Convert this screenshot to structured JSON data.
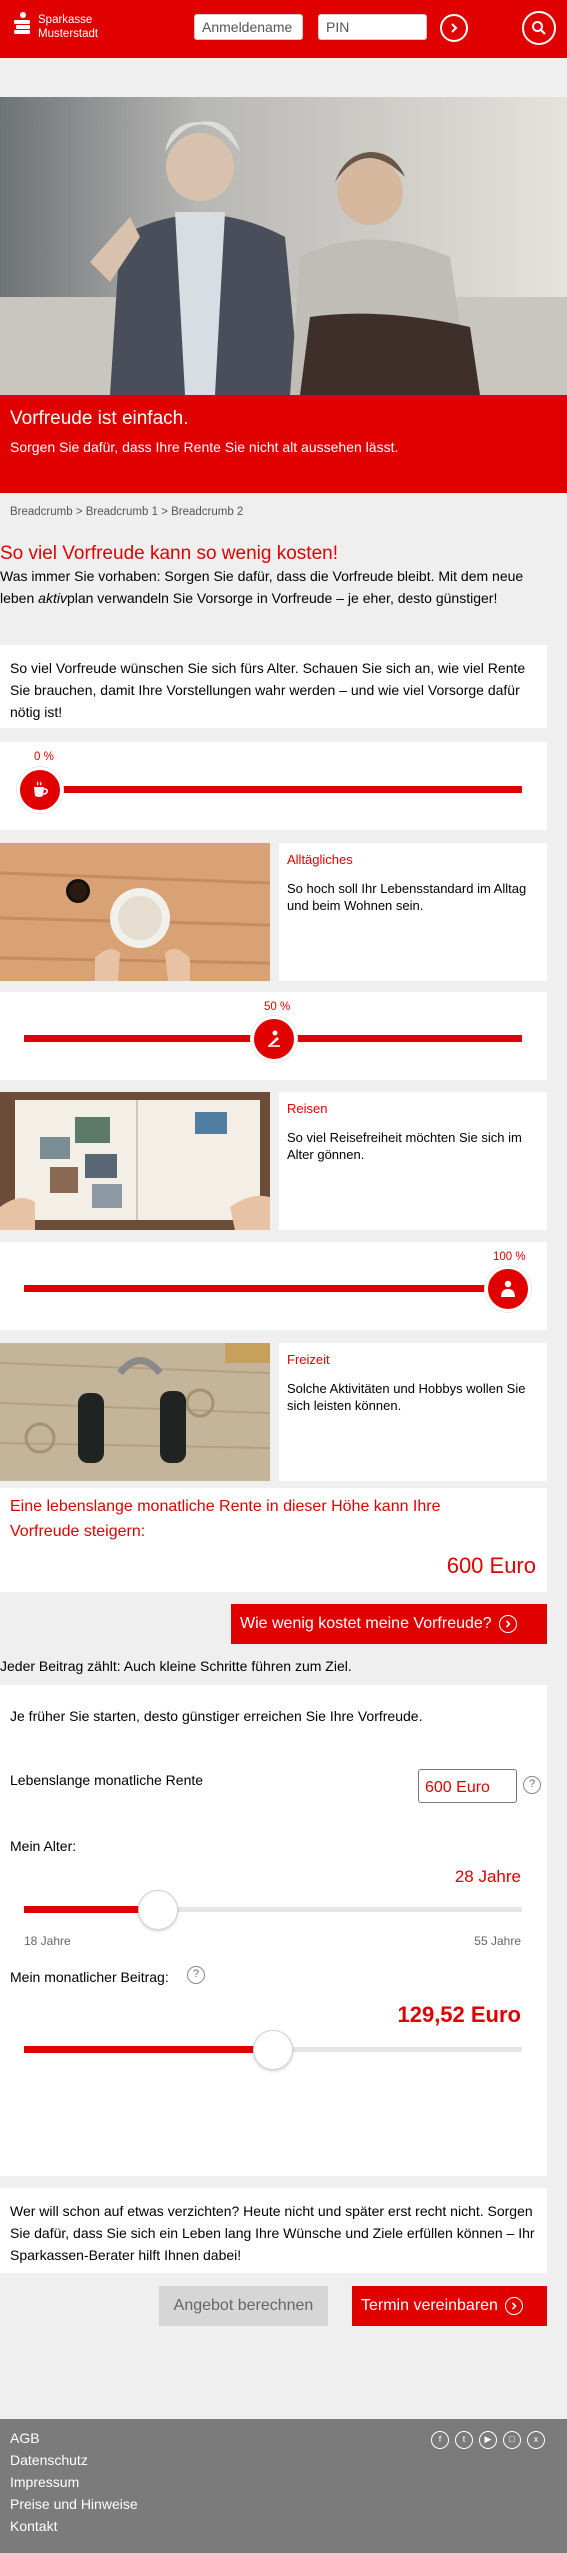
{
  "header": {
    "logo_line1": "Sparkasse",
    "logo_line2": "Musterstadt",
    "username_placeholder": "Anmeldename",
    "pin_placeholder": "PIN",
    "brand_color": "#e00000"
  },
  "hero": {
    "title": "Vorfreude ist einfach.",
    "subtitle": "Sorgen Sie dafür, dass Ihre Rente Sie nicht alt aussehen lässt."
  },
  "breadcrumb": "Breadcrumb > Breadcrumb 1 > Breadcrumb 2",
  "main": {
    "title": "So viel Vorfreude kann so wenig kosten!",
    "intro_part1": "Was immer Sie vorhaben: Sorgen Sie dafür, dass die Vorfreude bleibt. Mit dem neue leben ",
    "intro_em": "aktiv",
    "intro_part2": "plan verwandeln Sie Vorsorge in Vorfreude – je eher, desto günstiger!",
    "box_text": "So viel Vorfreude wünschen Sie sich fürs Alter. Schauen Sie sich an, wie viel Rente Sie brauchen, damit Ihre Vorstellungen wahr werden – und wie viel Vorsorge dafür nötig ist!"
  },
  "sliders": [
    {
      "label": "0 %",
      "value": 0,
      "icon": "coffee-cup-icon"
    },
    {
      "label": "50 %",
      "value": 0.5,
      "icon": "deckchair-icon"
    },
    {
      "label": "100 %",
      "value": 1,
      "icon": "person-icon"
    }
  ],
  "categories": [
    {
      "title": "Alltägliches",
      "text": "So hoch soll Ihr Lebensstandard im Alltag und beim Wohnen sein."
    },
    {
      "title": "Reisen",
      "text": "So viel Reisefreiheit möchten Sie sich im Alter gönnen."
    },
    {
      "title": "Freizeit",
      "text": "Solche Aktivitäten und Hobbys wollen Sie sich leisten können."
    }
  ],
  "result": {
    "text": "Eine lebenslange monatliche Rente in dieser Höhe kann Ihre Vorfreude steigern:",
    "amount": "600 Euro",
    "cta": "Wie wenig kostet meine Vorfreude?"
  },
  "calculator": {
    "note": "Jeder Beitrag zählt: Auch kleine Schritte führen zum Ziel.",
    "intro": "Je früher Sie starten, desto günstiger erreichen Sie Ihre Vorfreude.",
    "rente_label": "Lebenslange monatliche Rente",
    "rente_value": "600 Euro",
    "age_label": "Mein Alter:",
    "age_value": "28 Jahre",
    "age_level": 0.27,
    "age_min": "18 Jahre",
    "age_max": "55 Jahre",
    "beitrag_label": "Mein monatlicher Beitrag:",
    "beitrag_value": "129,52 Euro",
    "beitrag_level": 0.5
  },
  "bottom": {
    "text": "Wer will schon auf etwas verzichten? Heute nicht und später erst recht nicht. Sorgen Sie dafür, dass Sie sich ein Leben lang Ihre Wünsche und Ziele erfüllen können – Ihr Sparkassen-Berater hilft Ihnen dabei!",
    "btn_offer": "Angebot berechnen",
    "btn_appointment": "Termin vereinbaren"
  },
  "footer": {
    "links": [
      "AGB",
      "Datenschutz",
      "Impressum",
      "Preise und Hinweise",
      "Kontakt"
    ]
  }
}
